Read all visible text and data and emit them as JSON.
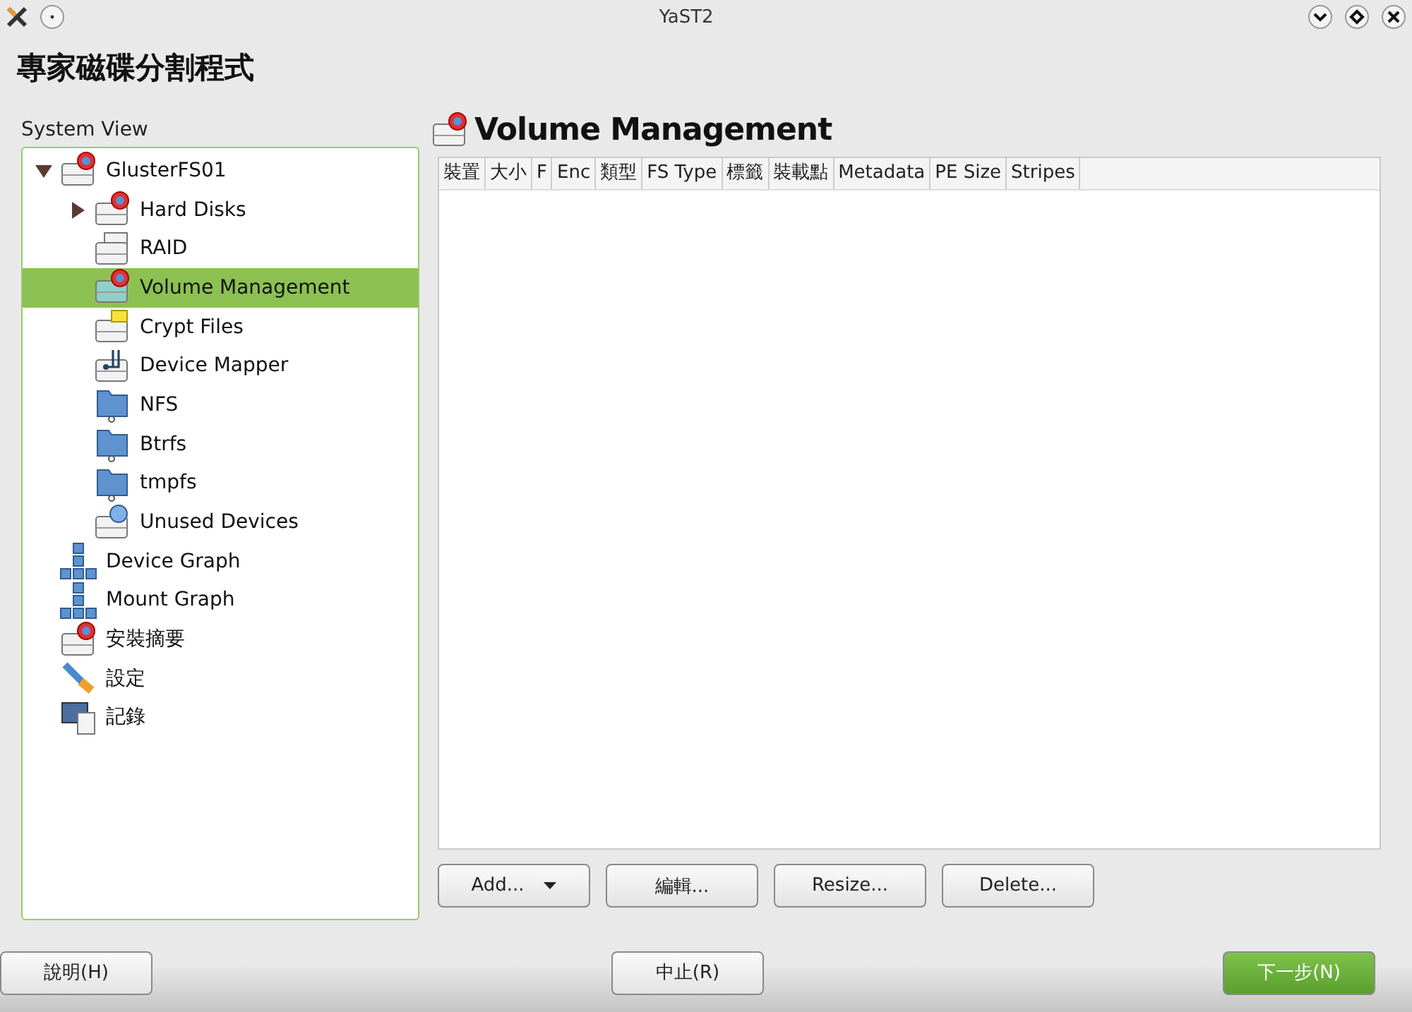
{
  "window": {
    "title": "YaST2"
  },
  "heading": "專家磁碟分割程式",
  "system_view": {
    "label": "System View",
    "tree": [
      {
        "label": "GlusterFS01",
        "kind": "disk",
        "expanded": true,
        "selected": false,
        "children": [
          {
            "label": "Hard Disks",
            "kind": "disk",
            "expanded": false,
            "selected": false
          },
          {
            "label": "RAID",
            "kind": "raid",
            "selected": false
          },
          {
            "label": "Volume Management",
            "kind": "lvm",
            "selected": true
          },
          {
            "label": "Crypt Files",
            "kind": "crypt",
            "selected": false
          },
          {
            "label": "Device Mapper",
            "kind": "mapper",
            "selected": false
          },
          {
            "label": "NFS",
            "kind": "folder",
            "selected": false
          },
          {
            "label": "Btrfs",
            "kind": "folder",
            "selected": false
          },
          {
            "label": "tmpfs",
            "kind": "folder",
            "selected": false
          },
          {
            "label": "Unused Devices",
            "kind": "unused",
            "selected": false
          }
        ]
      },
      {
        "label": "Device Graph",
        "kind": "graph",
        "selected": false
      },
      {
        "label": "Mount Graph",
        "kind": "graph",
        "selected": false
      },
      {
        "label": "安裝摘要",
        "kind": "disk",
        "selected": false
      },
      {
        "label": "設定",
        "kind": "settings",
        "selected": false
      },
      {
        "label": "記錄",
        "kind": "log",
        "selected": false
      }
    ]
  },
  "panel": {
    "title": "Volume Management",
    "table": {
      "columns": [
        "裝置",
        "大小",
        "F",
        "Enc",
        "類型",
        "FS Type",
        "標籤",
        "裝載點",
        "Metadata",
        "PE Size",
        "Stripes"
      ]
    },
    "buttons": [
      {
        "label": "Add...",
        "kind": "menu"
      },
      {
        "label": "編輯...",
        "kind": "plain"
      },
      {
        "label": "Resize...",
        "kind": "plain"
      },
      {
        "label": "Delete...",
        "kind": "plain"
      }
    ]
  },
  "footer": [
    {
      "label": "說明(H)",
      "kind": "plain"
    },
    {
      "label": "中止(R)",
      "kind": "plain"
    },
    {
      "label": "下一步(N)",
      "kind": "primary"
    }
  ]
}
